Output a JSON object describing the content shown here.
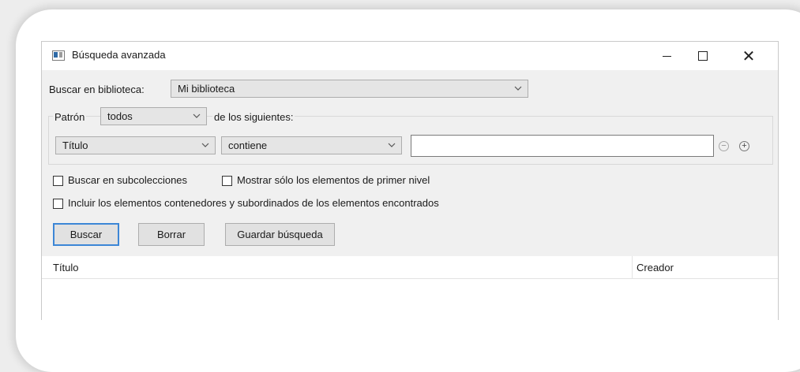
{
  "window": {
    "title": "Búsqueda avanzada"
  },
  "library": {
    "label": "Buscar en biblioteca:",
    "selected": "Mi biblioteca"
  },
  "pattern": {
    "label": "Patrón",
    "selected": "todos",
    "suffix": "de los siguientes:"
  },
  "condition": {
    "field": "Título",
    "operator": "contiene",
    "value": ""
  },
  "options": {
    "subcollections": "Buscar en subcolecciones",
    "top_level_only": "Mostrar sólo los elementos de primer nivel",
    "include_parents": "Incluir los elementos contenedores y subordinados de los elementos encontrados"
  },
  "buttons": {
    "search": "Buscar",
    "clear": "Borrar",
    "save": "Guardar búsqueda"
  },
  "results": {
    "columns": [
      "Título",
      "Creador"
    ]
  },
  "icons": {
    "minimize": "minimize-icon",
    "maximize": "maximize-icon",
    "close": "close-icon",
    "chevron": "chevron-down-icon",
    "remove": "remove-condition-icon",
    "add": "add-condition-icon"
  }
}
